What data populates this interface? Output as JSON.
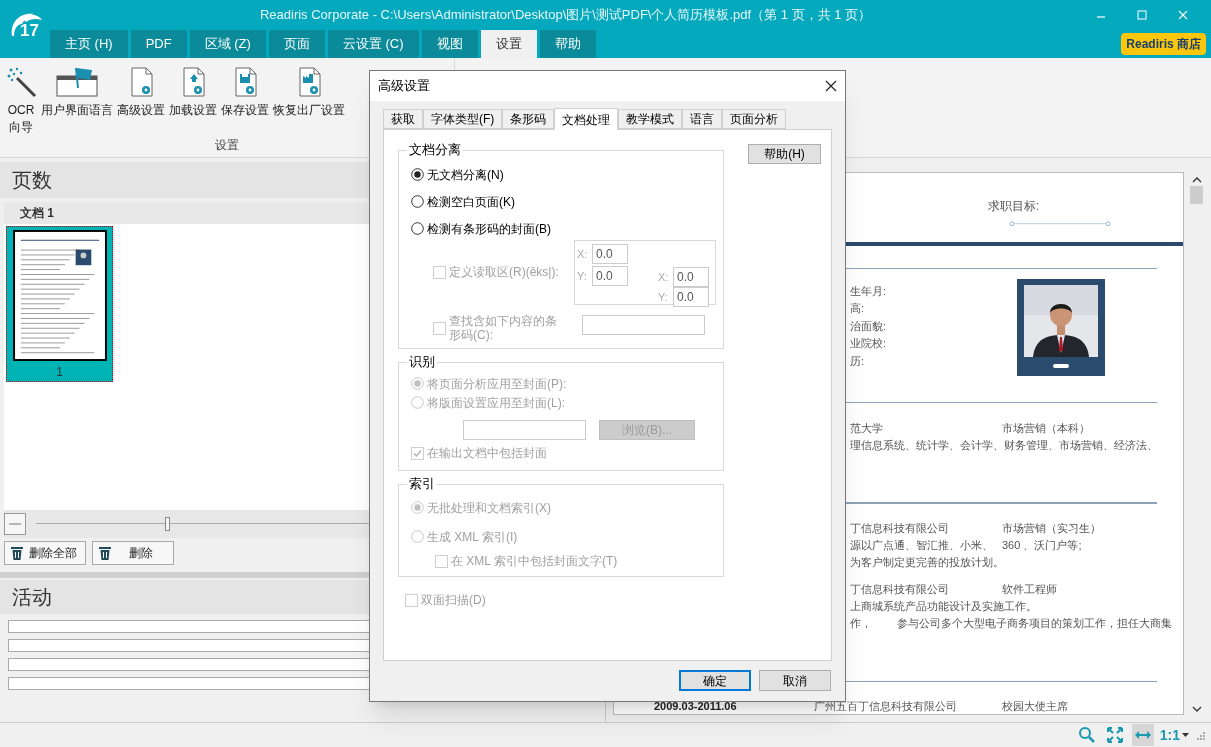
{
  "window": {
    "title": "Readiris Corporate - C:\\Users\\Administrator\\Desktop\\图片\\测试PDF\\个人简历模板.pdf（第 1 页，共 1 页）"
  },
  "app_logo": {
    "text": "17"
  },
  "ribbon_tabs": [
    {
      "label": "主页 (H)",
      "selected": false
    },
    {
      "label": "PDF",
      "selected": false
    },
    {
      "label": "区域 (Z)",
      "selected": false
    },
    {
      "label": "页面",
      "selected": false
    },
    {
      "label": "云设置 (C)",
      "selected": false
    },
    {
      "label": "视图",
      "selected": false
    },
    {
      "label": "设置",
      "selected": true
    },
    {
      "label": "帮助",
      "selected": false
    }
  ],
  "store_button": "Readiris 商店",
  "ribbon": {
    "group_label": "设置",
    "tools": [
      {
        "label": "OCR 向导",
        "kind": "wand"
      },
      {
        "label": "用户界面语言",
        "kind": "flag"
      },
      {
        "label": "高级设置",
        "kind": "doc"
      },
      {
        "label": "加载设置",
        "kind": "doc-upload"
      },
      {
        "label": "保存设置",
        "kind": "doc-save"
      },
      {
        "label": "恢复出厂设置",
        "kind": "doc-factory"
      }
    ]
  },
  "pages_panel": {
    "title": "页数",
    "document_group": "文档 1",
    "thumbnails": [
      {
        "label": "1",
        "selected": true
      }
    ],
    "zoom_slider": {
      "level": 0.23
    },
    "buttons": [
      "删除全部",
      "删除"
    ]
  },
  "activity_panel": {
    "title": "活动",
    "progress_bars": [
      {
        "level": 0
      },
      {
        "level": 0
      },
      {
        "level": 0
      },
      {
        "level": 0
      }
    ]
  },
  "preview": {
    "objective_label": "求职目标:",
    "info_labels": [
      "生年月:",
      "高:",
      "治面貌:",
      "业院校:",
      "历:"
    ],
    "sections": [
      {
        "rows": [
          {
            "kind": "two",
            "cells": [
              "范大学",
              "市场营销（本科）"
            ]
          },
          {
            "kind": "one",
            "cells": [
              "理信息系统、统计学、会计学、财务管理、市场营销、经济法、"
            ]
          }
        ]
      },
      {
        "rows": [
          {
            "kind": "two",
            "cells": [
              "丁信息科技有限公司",
              "市场营销（实习生）"
            ]
          },
          {
            "kind": "two",
            "cells": [
              "源以广点通、智汇推、小米、",
              "360 、沃门户等;"
            ]
          },
          {
            "kind": "one",
            "cells": [
              "为客户制定更完善的投放计划。"
            ]
          },
          {
            "kind": "two",
            "cells": [
              "丁信息科技有限公司",
              "软件工程师"
            ]
          },
          {
            "kind": "one",
            "cells": [
              "上商城系统产品功能设计及实施工作。"
            ]
          },
          {
            "kind": "wide",
            "cells": [
              "作，",
              "参与公司多个大型电子商务项目的策划工作，担任大商集"
            ]
          }
        ]
      },
      {
        "rows": [
          {
            "kind": "dated",
            "cells": [
              "2009.03-2011.06",
              "广州五百丁信息科技有限公司",
              "校园大使主席"
            ]
          }
        ]
      }
    ]
  },
  "status_bar": {
    "tools": [
      {
        "kind": "zoom",
        "selected": false
      },
      {
        "kind": "fit-page",
        "selected": false
      },
      {
        "kind": "fit-width",
        "selected": true
      }
    ],
    "zoom_label": "1:1"
  },
  "dialog": {
    "title": "高级设置",
    "tabs": [
      {
        "label": "获取",
        "selected": false
      },
      {
        "label": "字体类型(F)",
        "selected": false
      },
      {
        "label": "条形码",
        "selected": false
      },
      {
        "label": "文档处理",
        "selected": true
      },
      {
        "label": "教学模式",
        "selected": false
      },
      {
        "label": "语言",
        "selected": false
      },
      {
        "label": "页面分析",
        "selected": false
      }
    ],
    "help_button": "帮助(H)",
    "separation": {
      "title": "文档分离",
      "options": [
        {
          "label": "无文档分离(N)",
          "selected": true
        },
        {
          "label": "检测空白页面(K)",
          "selected": false
        },
        {
          "label": "检测有条形码的封面(B)",
          "selected": false
        }
      ],
      "read_zone": {
        "label": "定义读取区(R)(ēks|):",
        "checked": false,
        "disabled": true,
        "coords": [
          {
            "label": "X:",
            "value": "0.0"
          },
          {
            "label": "Y:",
            "value": "0.0"
          },
          {
            "label": "X:",
            "value": "0.0"
          },
          {
            "label": "Y:",
            "value": "0.0"
          }
        ]
      },
      "barcode_search": {
        "label": "查找含如下内容的条形码(C):",
        "checked": false,
        "disabled": true
      }
    },
    "recognition": {
      "title": "识别",
      "options": [
        {
          "label": "将页面分析应用至封面(P):",
          "selected": true,
          "disabled": true
        },
        {
          "label": "将版面设置应用至封面(L):",
          "selected": false,
          "disabled": true
        }
      ],
      "browse_button": "浏览(B)...",
      "include_cover": {
        "label": "在输出文档中包括封面",
        "checked": true,
        "disabled": true
      }
    },
    "index": {
      "title": "索引",
      "options": [
        {
          "label": "无批处理和文档索引(X)",
          "selected": true,
          "disabled": true
        },
        {
          "label": "生成 XML 索引(I)",
          "selected": false,
          "disabled": true
        }
      ],
      "include_text": {
        "label": "在 XML 索引中包括封面文字(T)",
        "checked": false,
        "disabled": true
      }
    },
    "duplex": {
      "label": "双面扫描(D)",
      "checked": false,
      "disabled": true
    },
    "buttons": [
      {
        "label": "确定",
        "default": true
      },
      {
        "label": "取消",
        "default": false
      }
    ]
  }
}
